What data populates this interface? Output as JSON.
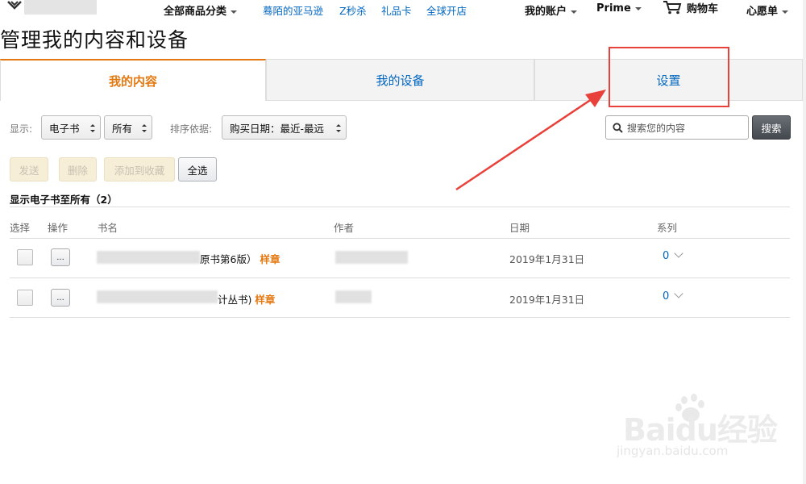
{
  "topnav": {
    "categories": "全部商品分类",
    "links": [
      "蓦陌的亚马逊",
      "Z秒杀",
      "礼品卡",
      "全球开店"
    ],
    "account": "我的账户",
    "prime": "Prime",
    "cart": "购物车",
    "wishlist": "心愿单"
  },
  "page_title": "管理我的内容和设备",
  "tabs": [
    "我的内容",
    "我的设备",
    "设置"
  ],
  "filters": {
    "show_label": "显示:",
    "type_value": "电子书",
    "scope_value": "所有",
    "sort_label": "排序依据:",
    "sort_value": "购买日期：最近-最远",
    "search_placeholder": "搜索您的内容",
    "search_button": "搜索"
  },
  "actions": [
    "发送",
    "删除",
    "添加到收藏",
    "全选"
  ],
  "count_line": "显示电子书至所有（2）",
  "table": {
    "headers": [
      "选择",
      "操作",
      "书名",
      "作者",
      "日期",
      "系列"
    ],
    "more_label": "...",
    "rows": [
      {
        "title_tail": "原书第6版）",
        "sample": "样章",
        "date": "2019年1月31日",
        "series": "0"
      },
      {
        "title_tail": "计丛书)",
        "sample": "样章",
        "date": "2019年1月31日",
        "series": "0"
      }
    ]
  },
  "watermark": {
    "main": "Baidu经验",
    "sub": "jingyan.baidu.com"
  },
  "colors": {
    "link": "#0066c0",
    "accent": "#e47911",
    "annotation": "#e8403a"
  }
}
